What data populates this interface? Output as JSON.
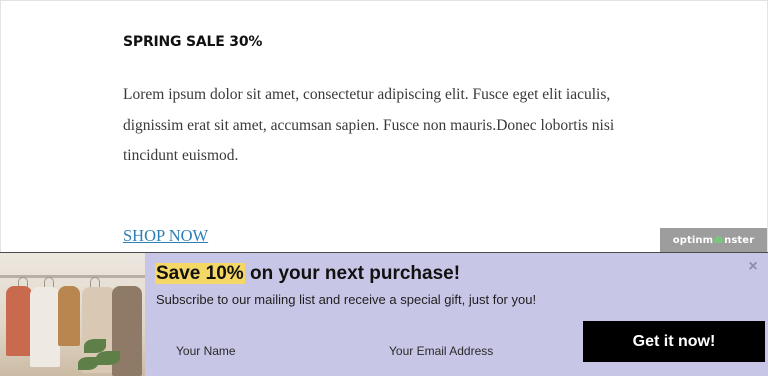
{
  "article": {
    "title": "SPRING SALE 30%",
    "body": "Lorem ipsum dolor sit amet, consectetur adipiscing elit. Fusce eget elit iaculis, dignissim erat sit amet, accumsan sapien. Fusce non mauris.Donec lobortis nisi tincidunt euismod.",
    "link_text": "SHOP NOW"
  },
  "badge": {
    "text_before": "optinm",
    "text_after": "nster"
  },
  "popup": {
    "headline_highlight": "Save 10%",
    "headline_rest": " on your next purchase!",
    "subtext": "Subscribe to our mailing list and receive a special gift, just for you!",
    "close_glyph": "×",
    "name_placeholder": "Your Name",
    "email_placeholder": "Your Email Address",
    "button_label": "Get it now!",
    "image_icon": "clothing-rack-photo"
  },
  "colors": {
    "bar_background": "#c8c6e6",
    "highlight": "#f5d766",
    "button": "#000000",
    "link": "#2e7fb5",
    "badge": "#9d9d9d"
  }
}
